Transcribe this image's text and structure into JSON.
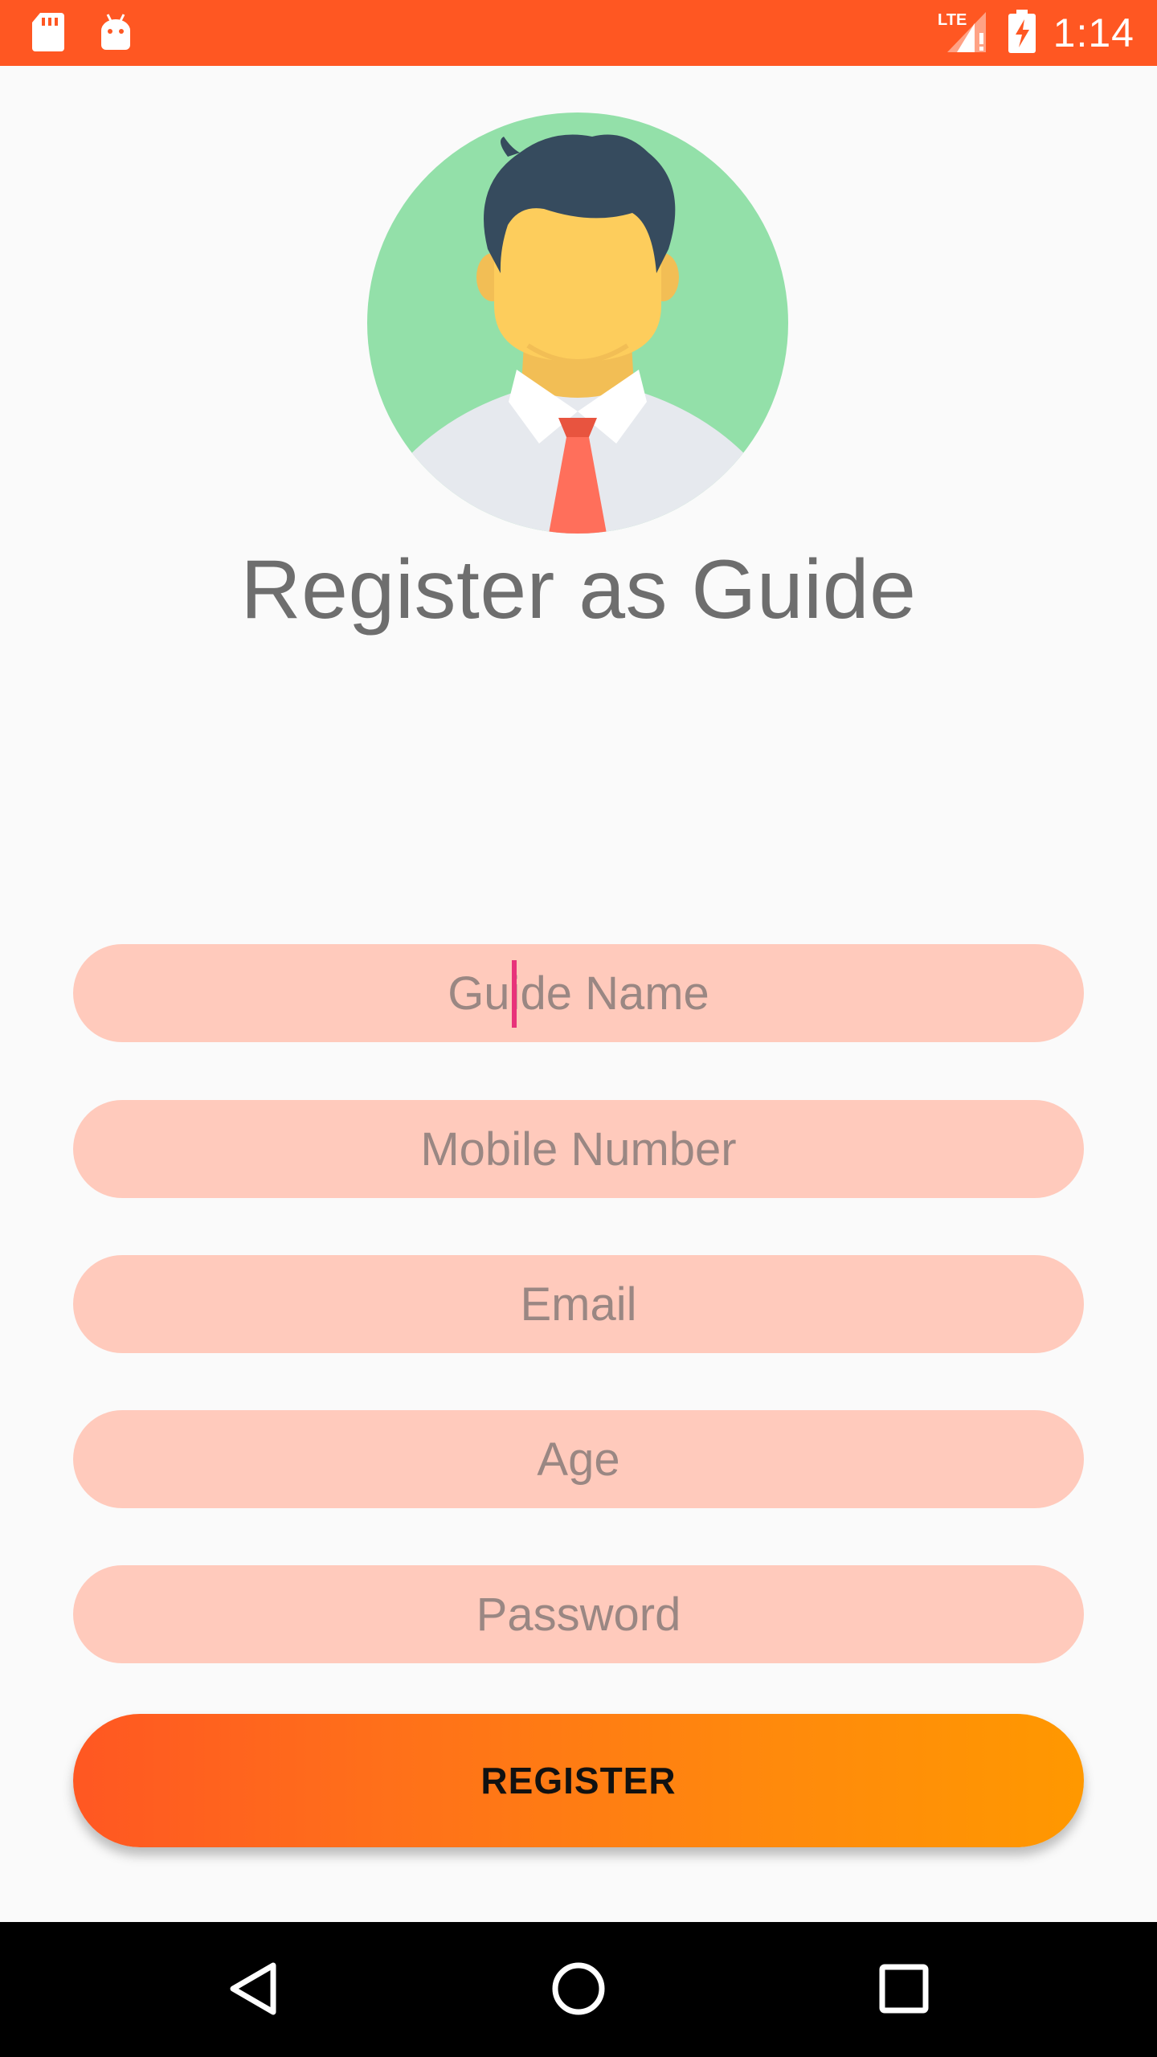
{
  "status_bar": {
    "time": "1:14",
    "network": "LTE",
    "icons": [
      "sd-card-icon",
      "android-icon",
      "signal-icon",
      "battery-charging-icon"
    ],
    "color": "#FF5722"
  },
  "header": {
    "title": "Register as Guide",
    "avatar": "guide-avatar"
  },
  "form": {
    "fields": [
      {
        "name": "guide-name",
        "placeholder": "Guide Name",
        "value": ""
      },
      {
        "name": "mobile-number",
        "placeholder": "Mobile Number",
        "value": ""
      },
      {
        "name": "email",
        "placeholder": "Email",
        "value": ""
      },
      {
        "name": "age",
        "placeholder": "Age",
        "value": ""
      },
      {
        "name": "password",
        "placeholder": "Password",
        "value": ""
      }
    ],
    "field_color": "#FFCABC",
    "submit_label": "REGISTER",
    "submit_gradient": [
      "#FF5722",
      "#FF9800"
    ]
  },
  "nav_bar": {
    "buttons": [
      "back-icon",
      "home-icon",
      "recents-icon"
    ]
  }
}
